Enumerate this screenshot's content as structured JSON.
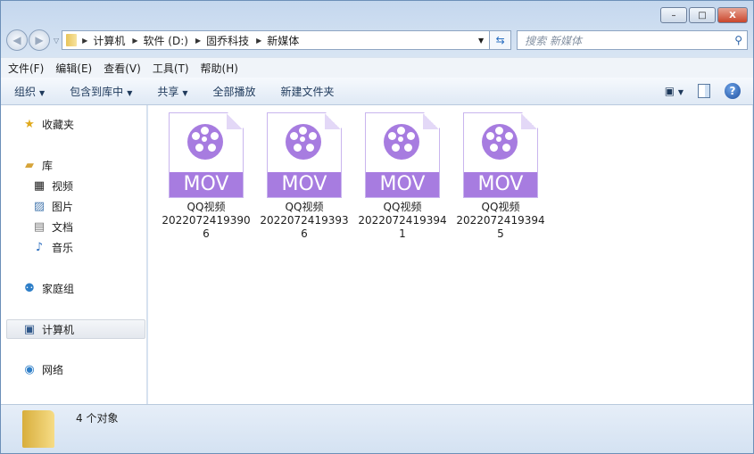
{
  "window": {
    "minimize": "–",
    "maximize": "□",
    "close": "X"
  },
  "address": {
    "crumbs": [
      "计算机",
      "软件 (D:)",
      "固乔科技",
      "新媒体"
    ]
  },
  "search": {
    "placeholder": "搜索 新媒体"
  },
  "menu": [
    "文件(F)",
    "编辑(E)",
    "查看(V)",
    "工具(T)",
    "帮助(H)"
  ],
  "toolbar": {
    "organize": "组织",
    "include": "包含到库中",
    "share": "共享",
    "play_all": "全部播放",
    "new_folder": "新建文件夹",
    "help": "?"
  },
  "sidebar": {
    "favorites": "收藏夹",
    "libraries": "库",
    "videos": "视频",
    "pictures": "图片",
    "documents": "文档",
    "music": "音乐",
    "homegroup": "家庭组",
    "computer": "计算机",
    "network": "网络"
  },
  "files": [
    {
      "name": "QQ视频20220724193906",
      "ext": "MOV"
    },
    {
      "name": "QQ视频20220724193936",
      "ext": "MOV"
    },
    {
      "name": "QQ视频20220724193941",
      "ext": "MOV"
    },
    {
      "name": "QQ视频20220724193945",
      "ext": "MOV"
    }
  ],
  "status": {
    "count": "4 个对象"
  }
}
